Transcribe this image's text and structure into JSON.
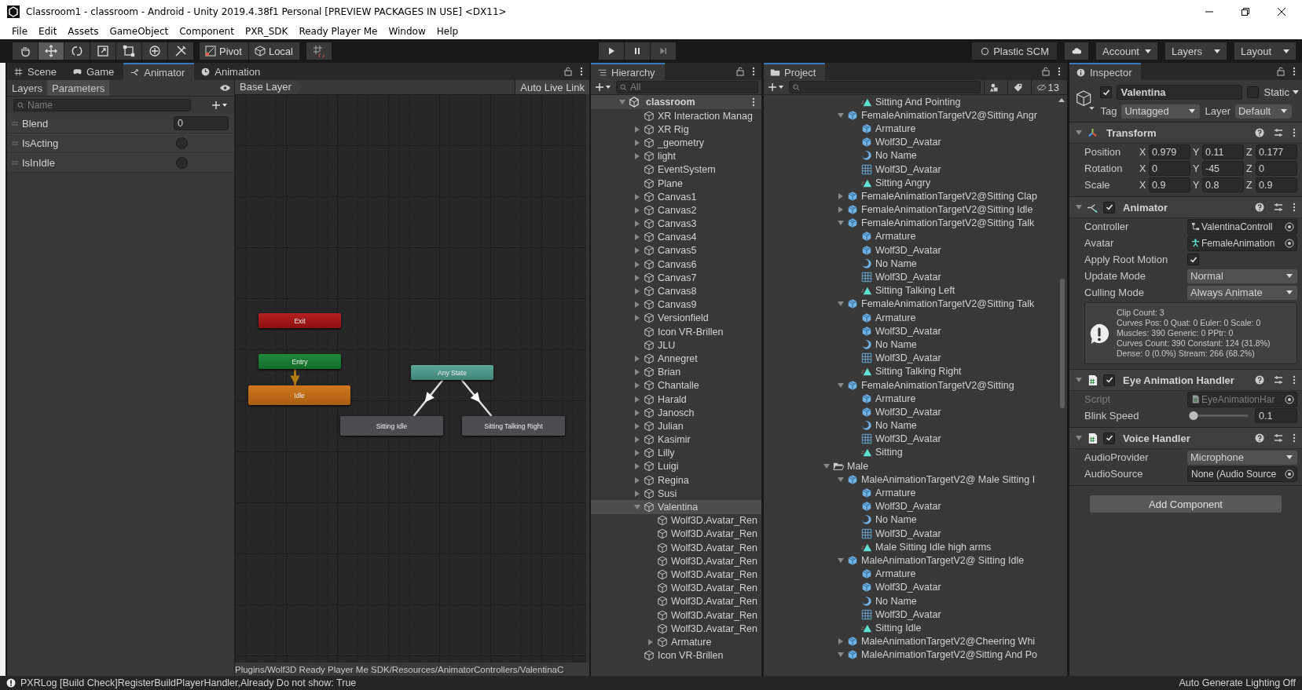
{
  "window": {
    "title": "Classroom1 - classroom - Android - Unity 2019.4.38f1 Personal [PREVIEW PACKAGES IN USE] <DX11>"
  },
  "menu": [
    "File",
    "Edit",
    "Assets",
    "GameObject",
    "Component",
    "PXR_SDK",
    "Ready Player Me",
    "Window",
    "Help"
  ],
  "toolbar": {
    "tools": [
      {
        "kind": "hand",
        "selected": false
      },
      {
        "kind": "move",
        "selected": true
      },
      {
        "kind": "rotate",
        "selected": false
      },
      {
        "kind": "scale",
        "selected": false
      },
      {
        "kind": "rect",
        "selected": false
      },
      {
        "kind": "transform",
        "selected": false
      },
      {
        "kind": "custom",
        "selected": false
      }
    ],
    "pivot": "Pivot",
    "local": "Local",
    "plastic": "Plastic SCM",
    "account": "Account",
    "layers": "Layers",
    "layout": "Layout"
  },
  "animator": {
    "tabs": [
      {
        "label": "Scene",
        "kind": "scene",
        "selected": false
      },
      {
        "label": "Game",
        "kind": "game",
        "selected": false
      },
      {
        "label": "Animator",
        "kind": "animator",
        "selected": true
      },
      {
        "label": "Animation",
        "kind": "animation",
        "selected": false
      }
    ],
    "subtabs": [
      {
        "label": "Layers",
        "selected": false
      },
      {
        "label": "Parameters",
        "selected": true
      }
    ],
    "breadcrumb": "Base Layer",
    "auto_live_link": "Auto Live Link",
    "search": {
      "placeholder": "Name"
    },
    "parameters": [
      {
        "name": "Blend",
        "kind": "float",
        "value": "0"
      },
      {
        "name": "IsActing",
        "kind": "bool",
        "checked": false
      },
      {
        "name": "IsInIdle",
        "kind": "bool",
        "checked": false
      }
    ],
    "states": [
      {
        "label": "Exit",
        "kind": "exit"
      },
      {
        "label": "Entry",
        "kind": "entry"
      },
      {
        "label": "Idle",
        "kind": "default"
      },
      {
        "label": "Any State",
        "kind": "any"
      },
      {
        "label": "Sitting Idle",
        "kind": "state"
      },
      {
        "label": "Sitting Talking Right",
        "kind": "state"
      }
    ],
    "transitions": [
      {
        "kind": "default"
      },
      {
        "kind": "normal"
      },
      {
        "kind": "normal"
      }
    ],
    "path": "Plugins/Wolf3D Ready Player Me SDK/Resources/AnimatorControllers/ValentinaC"
  },
  "hierarchy": {
    "title": "Hierarchy",
    "search": {
      "placeholder": "All"
    },
    "scene": {
      "name": "classroom",
      "expanded": true,
      "children": [
        {
          "name": "XR Interaction Manag",
          "selected": false
        },
        {
          "name": "XR Rig",
          "expanded": false,
          "selected": false
        },
        {
          "name": "_geometry",
          "expanded": false,
          "selected": false
        },
        {
          "name": "light",
          "expanded": false,
          "selected": false
        },
        {
          "name": "EventSystem",
          "selected": false
        },
        {
          "name": "Plane",
          "selected": false
        },
        {
          "name": "Canvas1",
          "expanded": false,
          "selected": false
        },
        {
          "name": "Canvas2",
          "expanded": false,
          "selected": false
        },
        {
          "name": "Canvas3",
          "expanded": false,
          "selected": false
        },
        {
          "name": "Canvas4",
          "expanded": false,
          "selected": false
        },
        {
          "name": "Canvas5",
          "expanded": false,
          "selected": false
        },
        {
          "name": "Canvas6",
          "expanded": false,
          "selected": false
        },
        {
          "name": "Canvas7",
          "expanded": false,
          "selected": false
        },
        {
          "name": "Canvas8",
          "expanded": false,
          "selected": false
        },
        {
          "name": "Canvas9",
          "expanded": false,
          "selected": false
        },
        {
          "name": "Versionfield",
          "expanded": false,
          "selected": false
        },
        {
          "name": "Icon VR-Brillen",
          "selected": false
        },
        {
          "name": "JLU",
          "selected": false
        },
        {
          "name": "Annegret",
          "expanded": false,
          "selected": false
        },
        {
          "name": "Brian",
          "expanded": false,
          "selected": false
        },
        {
          "name": "Chantalle",
          "expanded": false,
          "selected": false
        },
        {
          "name": "Harald",
          "expanded": false,
          "selected": false
        },
        {
          "name": "Janosch",
          "expanded": false,
          "selected": false
        },
        {
          "name": "Julian",
          "expanded": false,
          "selected": false
        },
        {
          "name": "Kasimir",
          "expanded": false,
          "selected": false
        },
        {
          "name": "Lilly",
          "expanded": false,
          "selected": false
        },
        {
          "name": "Luigi",
          "expanded": false,
          "selected": false
        },
        {
          "name": "Regina",
          "expanded": false,
          "selected": false
        },
        {
          "name": "Susi",
          "expanded": false,
          "selected": false
        },
        {
          "name": "Valentina",
          "expanded": true,
          "selected": true,
          "children": [
            {
              "name": "Wolf3D.Avatar_Ren",
              "selected": false
            },
            {
              "name": "Wolf3D.Avatar_Ren",
              "selected": false
            },
            {
              "name": "Wolf3D.Avatar_Ren",
              "selected": false
            },
            {
              "name": "Wolf3D.Avatar_Ren",
              "selected": false
            },
            {
              "name": "Wolf3D.Avatar_Ren",
              "selected": false
            },
            {
              "name": "Wolf3D.Avatar_Ren",
              "selected": false
            },
            {
              "name": "Wolf3D.Avatar_Ren",
              "selected": false
            },
            {
              "name": "Wolf3D.Avatar_Ren",
              "selected": false
            },
            {
              "name": "Wolf3D.Avatar_Ren",
              "selected": false
            },
            {
              "name": "Armature",
              "expanded": false,
              "selected": false
            }
          ]
        },
        {
          "name": "Icon VR-Brillen",
          "selected": false
        }
      ]
    }
  },
  "project": {
    "title": "Project",
    "hidden_count": "13",
    "tree": [
      {
        "children": [
          {
            "children": [
              {
                "name": "Sitting And Pointing",
                "kind": "clip"
              }
            ]
          },
          {
            "name": "FemaleAnimationTargetV2@Sitting Angr",
            "kind": "model",
            "expanded": true,
            "children": [
              {
                "name": "Armature",
                "kind": "model"
              },
              {
                "name": "Wolf3D_Avatar",
                "kind": "model"
              },
              {
                "name": "No Name",
                "kind": "avatar"
              },
              {
                "name": "Wolf3D_Avatar",
                "kind": "mesh"
              },
              {
                "name": "Sitting Angry",
                "kind": "clip"
              }
            ]
          },
          {
            "name": "FemaleAnimationTargetV2@Sitting Clap",
            "kind": "model",
            "expanded": false
          },
          {
            "name": "FemaleAnimationTargetV2@Sitting Idle",
            "kind": "model",
            "expanded": false
          },
          {
            "name": "FemaleAnimationTargetV2@Sitting Talk",
            "kind": "model",
            "expanded": true,
            "children": [
              {
                "name": "Armature",
                "kind": "model"
              },
              {
                "name": "Wolf3D_Avatar",
                "kind": "model"
              },
              {
                "name": "No Name",
                "kind": "avatar"
              },
              {
                "name": "Wolf3D_Avatar",
                "kind": "mesh"
              },
              {
                "name": "Sitting Talking Left",
                "kind": "clip"
              }
            ]
          },
          {
            "name": "FemaleAnimationTargetV2@Sitting Talk",
            "kind": "model",
            "expanded": true,
            "children": [
              {
                "name": "Armature",
                "kind": "model"
              },
              {
                "name": "Wolf3D_Avatar",
                "kind": "model"
              },
              {
                "name": "No Name",
                "kind": "avatar"
              },
              {
                "name": "Wolf3D_Avatar",
                "kind": "mesh"
              },
              {
                "name": "Sitting Talking Right",
                "kind": "clip"
              }
            ]
          },
          {
            "name": "FemaleAnimationTargetV2@Sitting",
            "kind": "model",
            "expanded": true,
            "children": [
              {
                "name": "Armature",
                "kind": "model"
              },
              {
                "name": "Wolf3D_Avatar",
                "kind": "model"
              },
              {
                "name": "No Name",
                "kind": "avatar"
              },
              {
                "name": "Wolf3D_Avatar",
                "kind": "mesh"
              },
              {
                "name": "Sitting",
                "kind": "clip"
              }
            ]
          }
        ]
      },
      {
        "name": "Male",
        "kind": "folder",
        "expanded": true,
        "children": [
          {
            "name": "MaleAnimationTargetV2@ Male Sitting I",
            "kind": "model",
            "expanded": true,
            "children": [
              {
                "name": "Armature",
                "kind": "model"
              },
              {
                "name": "Wolf3D_Avatar",
                "kind": "model"
              },
              {
                "name": "No Name",
                "kind": "avatar"
              },
              {
                "name": "Wolf3D_Avatar",
                "kind": "mesh"
              },
              {
                "name": "Male Sitting Idle high arms",
                "kind": "clip"
              }
            ]
          },
          {
            "name": "MaleAnimationTargetV2@ Sitting Idle",
            "kind": "model",
            "expanded": true,
            "children": [
              {
                "name": "Armature",
                "kind": "model"
              },
              {
                "name": "Wolf3D_Avatar",
                "kind": "model"
              },
              {
                "name": "No Name",
                "kind": "avatar"
              },
              {
                "name": "Wolf3D_Avatar",
                "kind": "mesh"
              },
              {
                "name": "Sitting Idle",
                "kind": "clip"
              }
            ]
          },
          {
            "name": "MaleAnimationTargetV2@Cheering Whi",
            "kind": "model",
            "expanded": false
          },
          {
            "name": "MaleAnimationTargetV2@Sitting And Po",
            "kind": "model",
            "expanded": true
          }
        ]
      }
    ]
  },
  "inspector": {
    "title": "Inspector",
    "object": {
      "active": true,
      "name": "Valentina",
      "static": false,
      "static_label": "Static",
      "tag_label": "Tag",
      "tag": "Untagged",
      "layer_label": "Layer",
      "layer": "Default"
    },
    "components": [
      {
        "name": "Transform",
        "kind": "transform",
        "expanded": true,
        "fields": [
          {
            "label": "Position",
            "kind": "vector",
            "values": [
              {
                "axis": "X",
                "value": "0.979"
              },
              {
                "axis": "Y",
                "value": "0.11"
              },
              {
                "axis": "Z",
                "value": "0.177"
              }
            ]
          },
          {
            "label": "Rotation",
            "kind": "vector",
            "values": [
              {
                "axis": "X",
                "value": "0"
              },
              {
                "axis": "Y",
                "value": "-45"
              },
              {
                "axis": "Z",
                "value": "0"
              }
            ]
          },
          {
            "label": "Scale",
            "kind": "vector",
            "values": [
              {
                "axis": "X",
                "value": "0.9"
              },
              {
                "axis": "Y",
                "value": "0.8"
              },
              {
                "axis": "Z",
                "value": "0.9"
              }
            ]
          }
        ]
      },
      {
        "name": "Animator",
        "kind": "animator",
        "expanded": true,
        "enabled": true,
        "fields": [
          {
            "label": "Controller",
            "kind": "object",
            "value": "ValentinaControll",
            "disabled": false
          },
          {
            "label": "Avatar",
            "kind": "object",
            "value": "FemaleAnimation",
            "disabled": false
          },
          {
            "label": "Apply Root Motion",
            "kind": "toggle",
            "checked": true
          },
          {
            "label": "Update Mode",
            "kind": "dropdown",
            "value": "Normal"
          },
          {
            "label": "Culling Mode",
            "kind": "dropdown",
            "value": "Always Animate"
          },
          {
            "kind": "info",
            "lines": [
              "Clip Count: 3",
              "Curves Pos: 0 Quat: 0 Euler: 0 Scale: 0",
              "Muscles: 390 Generic: 0 PPtr: 0",
              "Curves Count: 390 Constant: 124 (31.8%)",
              "Dense: 0 (0.0%) Stream: 266 (68.2%)"
            ]
          }
        ]
      },
      {
        "name": "Eye Animation Handler",
        "kind": "script",
        "expanded": true,
        "enabled": true,
        "fields": [
          {
            "label": "Script",
            "kind": "object",
            "value": "EyeAnimationHar",
            "disabled": true
          },
          {
            "label": "Blink Speed",
            "kind": "slider",
            "level": 0.08,
            "value": "0.1"
          }
        ]
      },
      {
        "name": "Voice Handler",
        "kind": "script",
        "expanded": true,
        "enabled": true,
        "fields": [
          {
            "label": "AudioProvider",
            "kind": "dropdown",
            "value": "Microphone"
          },
          {
            "label": "AudioSource",
            "kind": "object",
            "value": "None (Audio Source",
            "disabled": false
          }
        ]
      }
    ],
    "add_component": "Add Component"
  },
  "status_bar": {
    "message": "PXRLog [Build Check]RegisterBuildPlayerHandler,Already Do not show: True",
    "right": "Auto Generate Lighting Off"
  }
}
